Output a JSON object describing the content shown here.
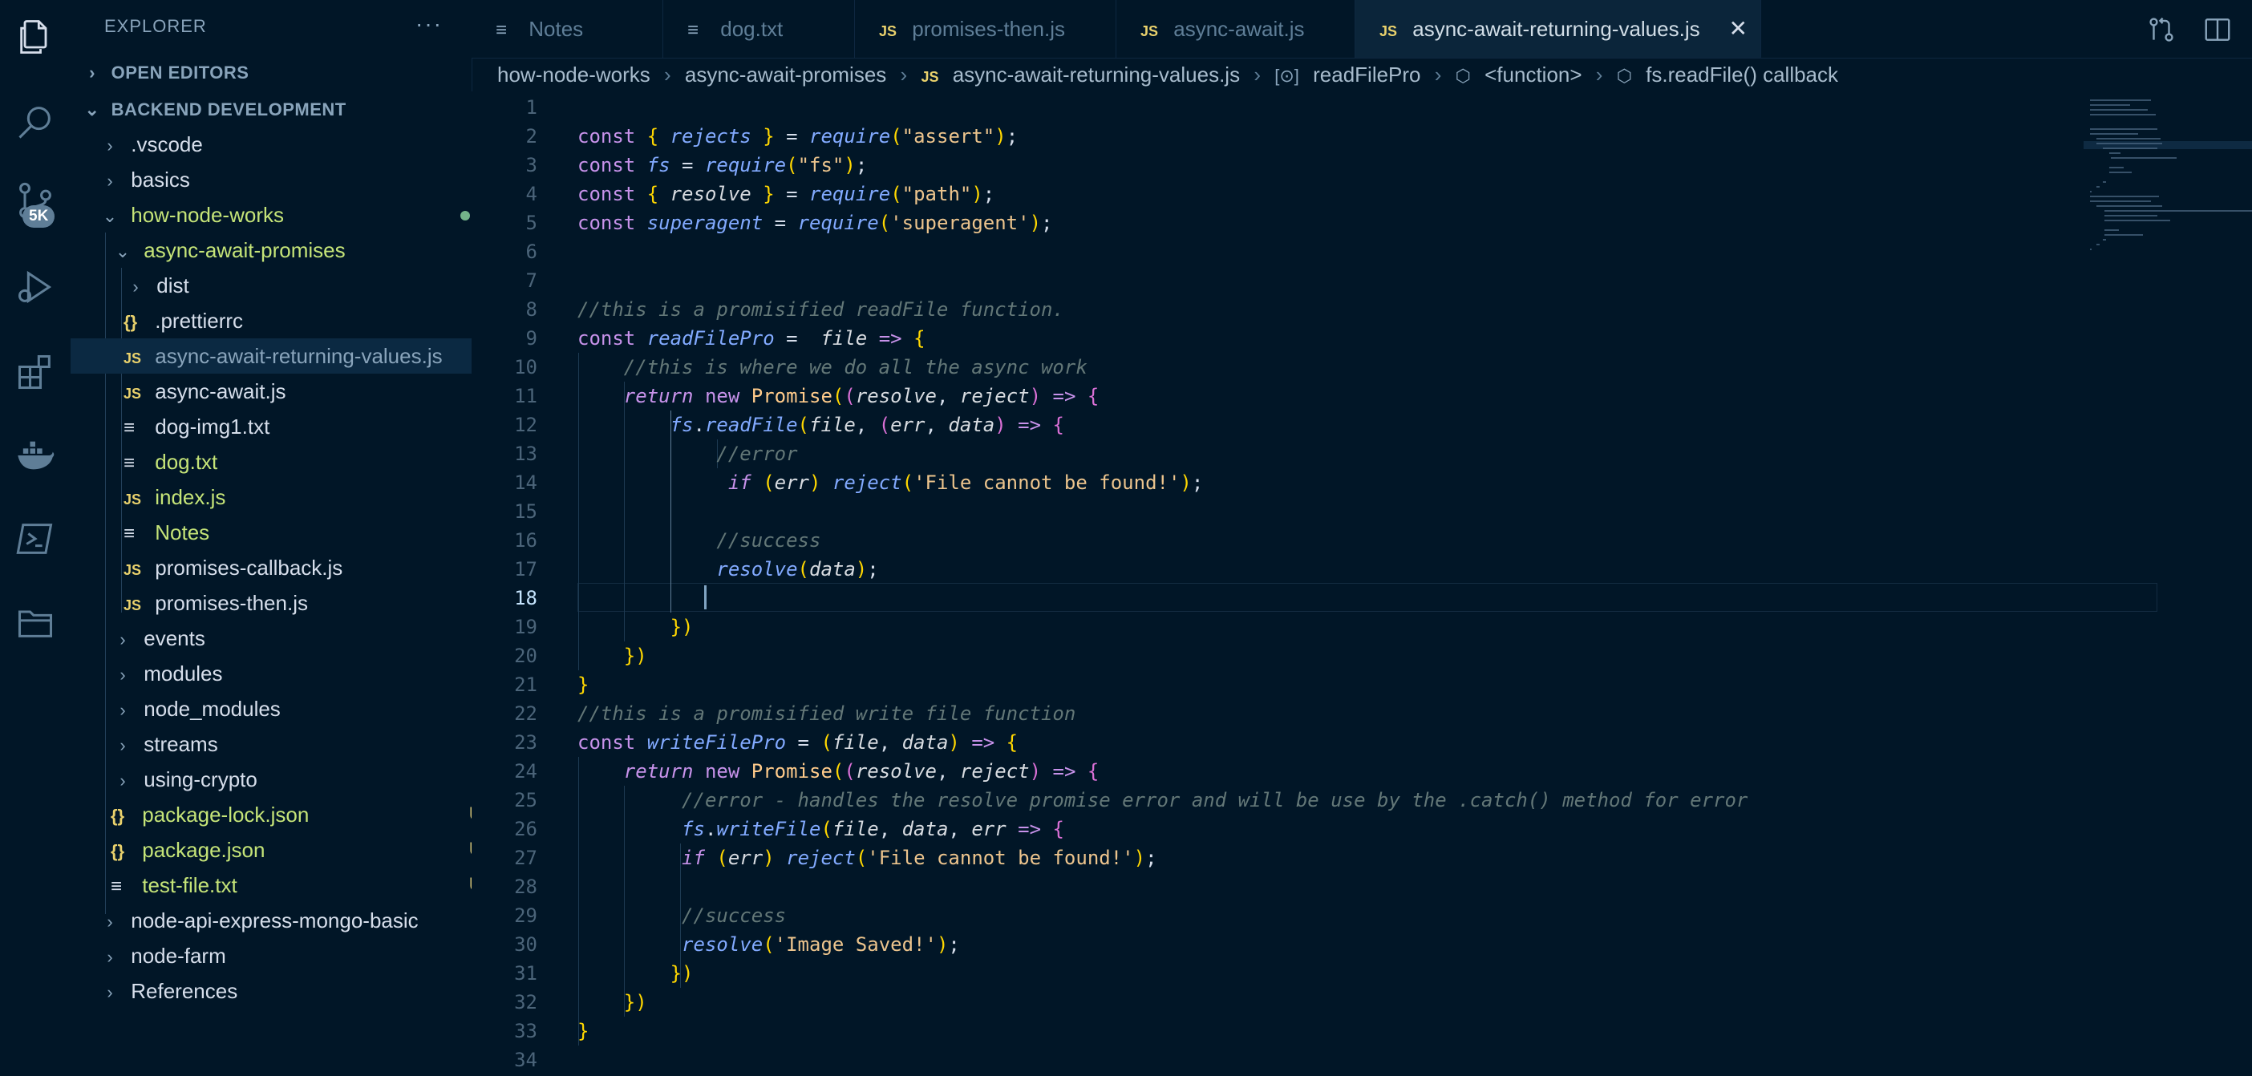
{
  "activity_bar": {
    "icons": [
      "explorer-icon",
      "search-icon",
      "source-control-icon",
      "run-debug-icon",
      "extensions-icon",
      "docker-icon",
      "terminal-icon",
      "remote-explorer-icon"
    ],
    "source_control_badge": "5K"
  },
  "sidebar": {
    "title": "EXPLORER",
    "more": "···",
    "open_editors": "OPEN EDITORS",
    "workspace": "BACKEND DEVELOPMENT",
    "tree": [
      {
        "label": ".vscode",
        "type": "folder"
      },
      {
        "label": "basics",
        "type": "folder"
      },
      {
        "label": "how-node-works",
        "type": "folder-open"
      },
      {
        "label": "async-await-promises",
        "type": "folder-open"
      },
      {
        "label": "dist",
        "type": "folder"
      },
      {
        "label": ".prettierrc",
        "type": "json"
      },
      {
        "label": "async-await-returning-values.js",
        "type": "js"
      },
      {
        "label": "async-await.js",
        "type": "js"
      },
      {
        "label": "dog-img1.txt",
        "type": "txt"
      },
      {
        "label": "dog.txt",
        "type": "txt",
        "git": "U"
      },
      {
        "label": "index.js",
        "type": "js",
        "git": "U"
      },
      {
        "label": "Notes",
        "type": "txt",
        "git": "U"
      },
      {
        "label": "promises-callback.js",
        "type": "js"
      },
      {
        "label": "promises-then.js",
        "type": "js"
      },
      {
        "label": "events",
        "type": "folder"
      },
      {
        "label": "modules",
        "type": "folder"
      },
      {
        "label": "node_modules",
        "type": "folder"
      },
      {
        "label": "streams",
        "type": "folder"
      },
      {
        "label": "using-crypto",
        "type": "folder"
      },
      {
        "label": "package-lock.json",
        "type": "json",
        "git": "U"
      },
      {
        "label": "package.json",
        "type": "json",
        "git": "U"
      },
      {
        "label": "test-file.txt",
        "type": "txt",
        "git": "U"
      },
      {
        "label": "node-api-express-mongo-basic",
        "type": "folder"
      },
      {
        "label": "node-farm",
        "type": "folder"
      },
      {
        "label": "References",
        "type": "folder"
      }
    ]
  },
  "tabs": [
    {
      "label": "Notes",
      "icon": "≡"
    },
    {
      "label": "dog.txt",
      "icon": "≡"
    },
    {
      "label": "promises-then.js",
      "icon": "JS"
    },
    {
      "label": "async-await.js",
      "icon": "JS"
    },
    {
      "label": "async-await-returning-values.js",
      "icon": "JS",
      "close": "✕"
    }
  ],
  "breadcrumb": [
    "how-node-works",
    "async-await-promises",
    "async-await-returning-values.js",
    "readFilePro",
    "<function>",
    "fs.readFile() callback"
  ],
  "editor": {
    "line_numbers": [
      "1",
      "2",
      "3",
      "4",
      "5",
      "6",
      "7",
      "8",
      "9",
      "10",
      "11",
      "12",
      "13",
      "14",
      "15",
      "16",
      "17",
      "18",
      "19",
      "20",
      "21",
      "22",
      "23",
      "24",
      "25",
      "26",
      "27",
      "28",
      "29",
      "30",
      "31",
      "32",
      "33",
      "34"
    ],
    "lines": [
      "",
      "const { rejects } = require(\"assert\");",
      "const fs = require(\"fs\");",
      "const { resolve } = require(\"path\");",
      "const superagent = require('superagent');",
      "",
      "",
      "//this is a promisified readFile function.",
      "const readFilePro =  file => {",
      "    //this is where we do all the async work",
      "    return new Promise((resolve, reject) => {",
      "        fs.readFile(file, (err, data) => {",
      "            //error",
      "             if (err) reject('File cannot be found!');",
      "",
      "            //success",
      "            resolve(data);",
      "",
      "        })",
      "    })",
      "}",
      "//this is a promisified write file function",
      "const writeFilePro = (file, data) => {",
      "    return new Promise((resolve, reject) => {",
      "         //error - handles the resolve promise error and will be use by the .catch() method for error",
      "         fs.writeFile(file, data, err => {",
      "         if (err) reject('File cannot be found!');",
      "",
      "         //success",
      "         resolve('Image Saved!');",
      "        })",
      "    })",
      "}",
      ""
    ]
  }
}
